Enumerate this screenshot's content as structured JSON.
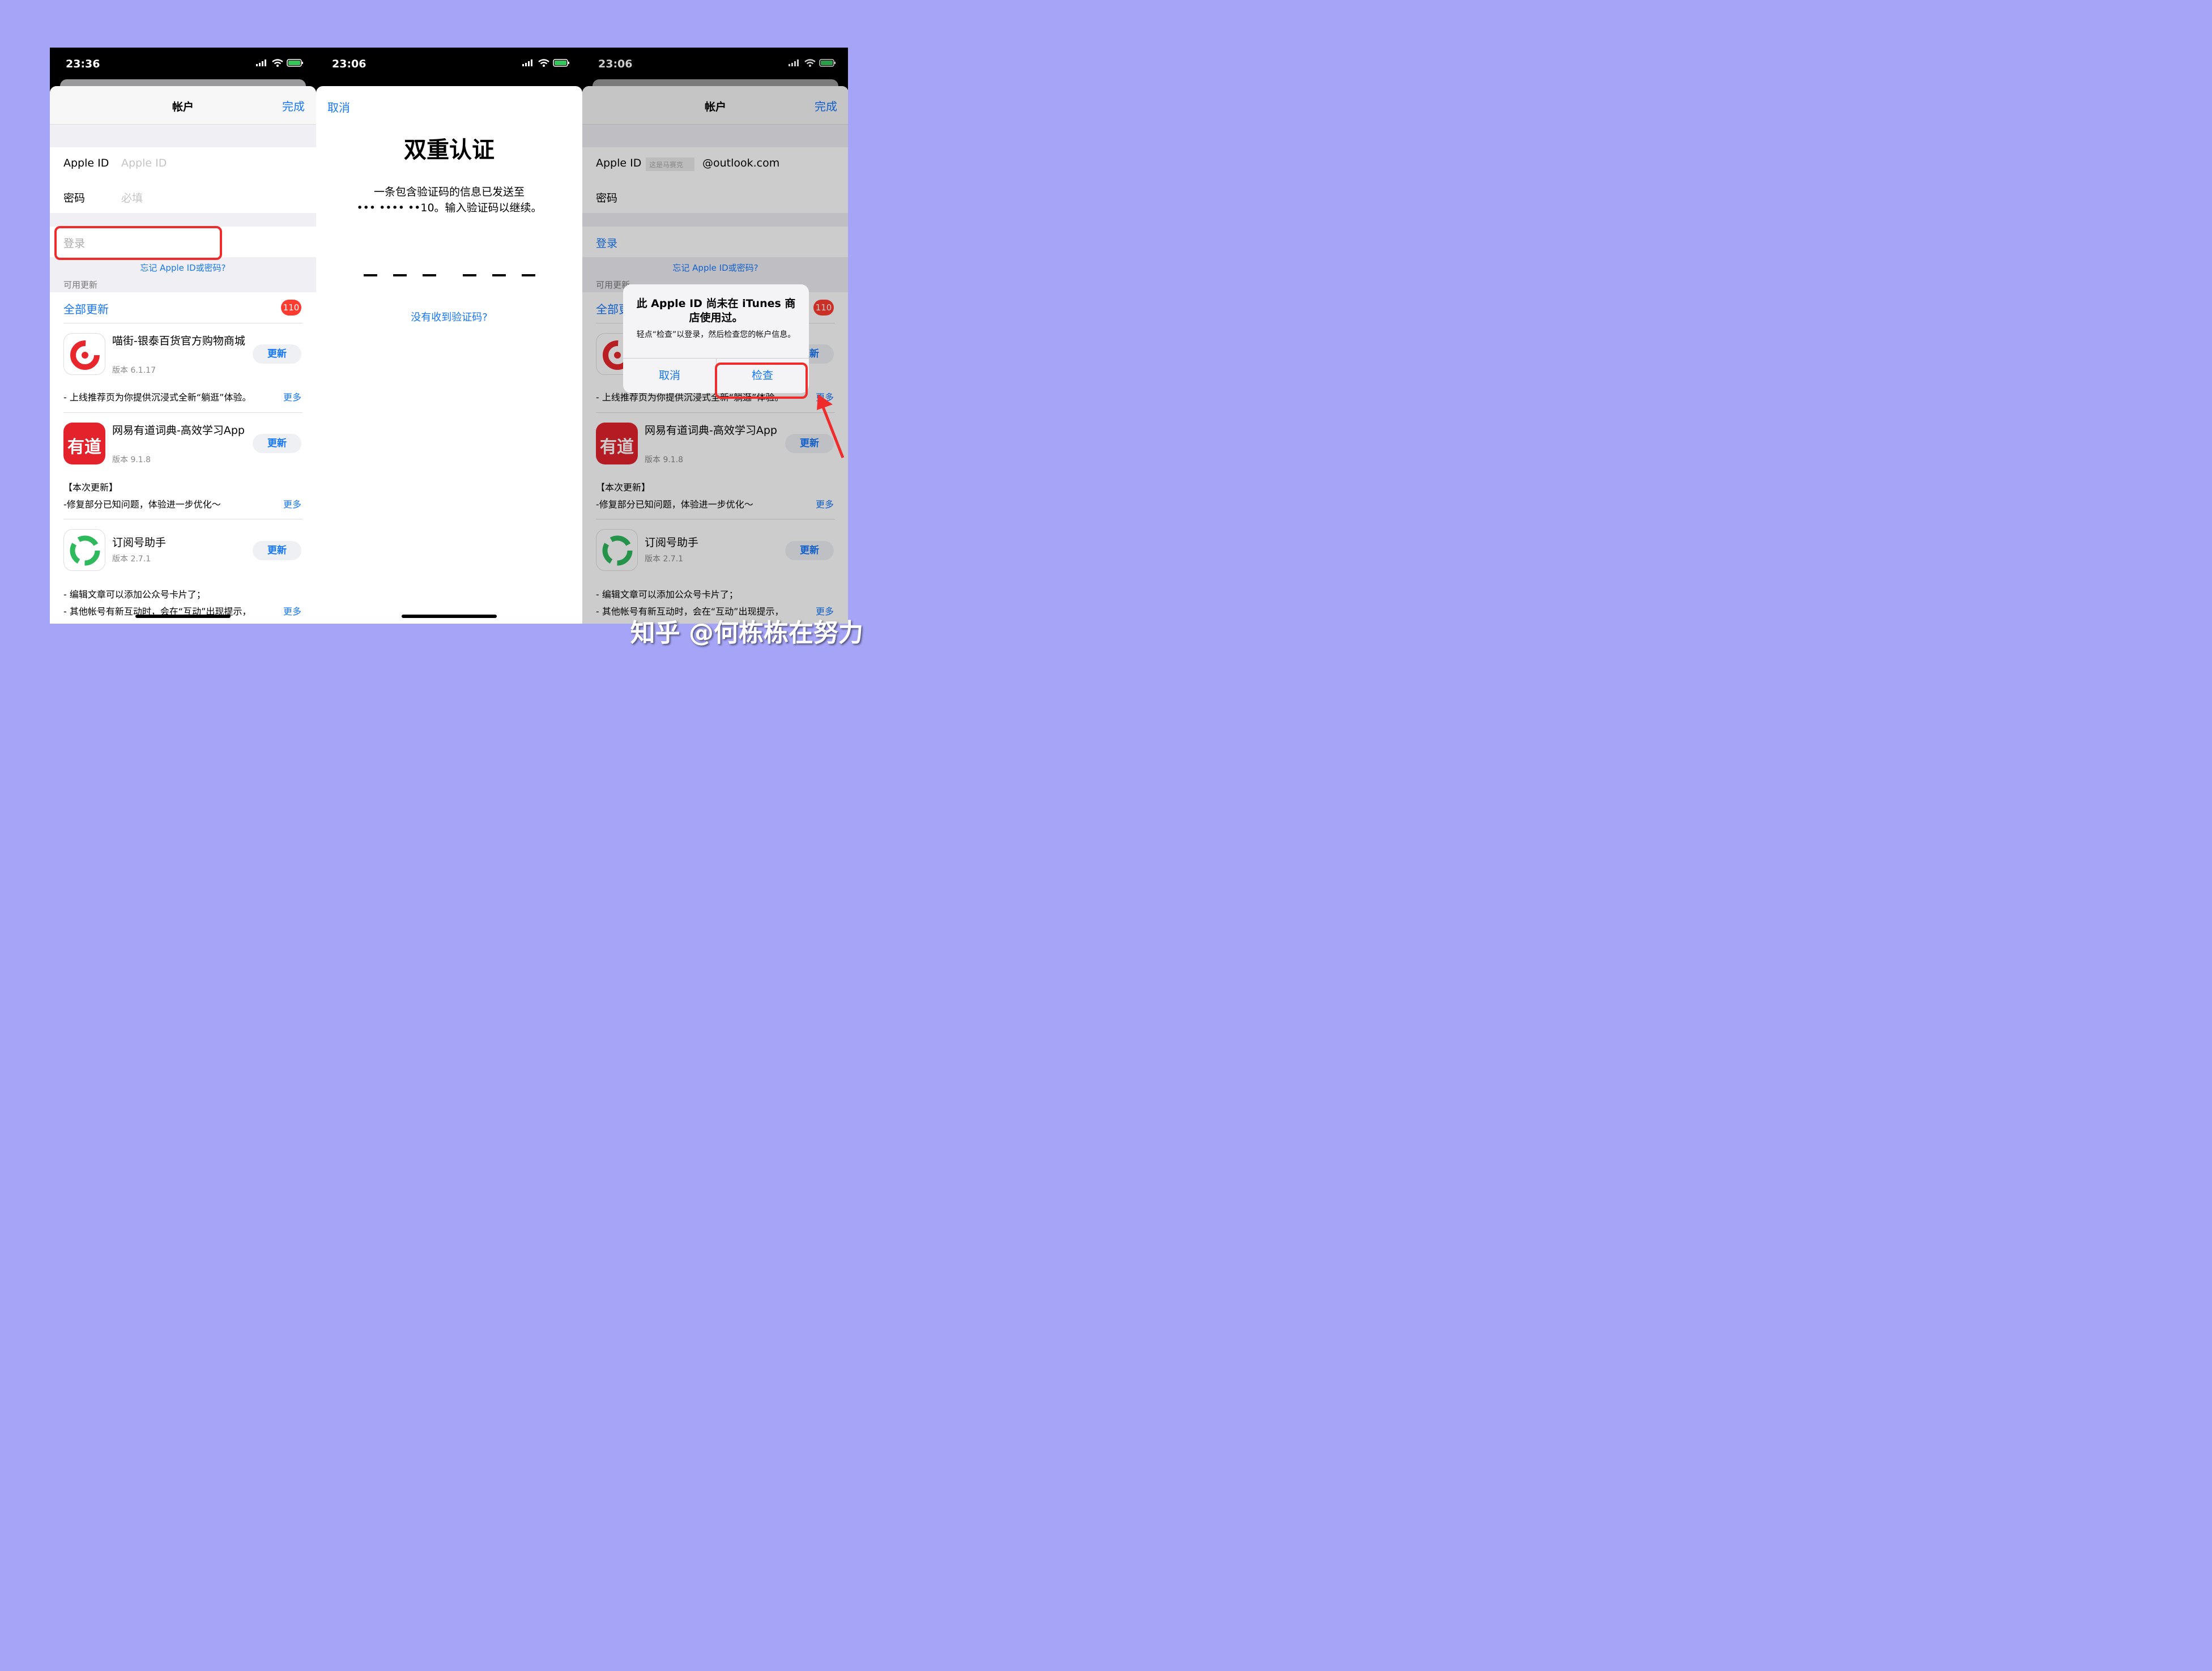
{
  "status_bar": [
    {
      "time": "23:36"
    },
    {
      "time": "23:06"
    },
    {
      "time": "23:06"
    }
  ],
  "account_panel": {
    "title": "帐户",
    "done": "完成",
    "apple_id_label": "Apple ID",
    "apple_id_placeholder": "Apple ID",
    "password_label": "密码",
    "password_placeholder": "必填",
    "login": "登录",
    "forgot": "忘记 Apple ID或密码?",
    "available_updates": "可用更新",
    "update_all": "全部更新",
    "badge_count": "110",
    "apps": [
      {
        "name": "喵街-银泰百货官方购物商城",
        "version": "版本 6.1.17",
        "button": "更新",
        "note": "- 上线推荐页为你提供沉浸式全新“躺逛”体验。",
        "more": "更多"
      },
      {
        "name": "网易有道词典-高效学习App",
        "version": "版本 9.1.8",
        "button": "更新",
        "note_title": "【本次更新】",
        "note": "-修复部分已知问题，体验进一步优化～",
        "more": "更多",
        "icon_text": "有道"
      },
      {
        "name": "订阅号助手",
        "version": "版本 2.7.1",
        "button": "更新",
        "note_line1": "- 编辑文章可以添加公众号卡片了；",
        "note_line2": "- 其他帐号有新互动时，会在“互动”出现提示，",
        "more": "更多"
      }
    ]
  },
  "two_factor": {
    "cancel": "取消",
    "title": "双重认证",
    "message_line1": "一条包含验证码的信息已发送至",
    "message_line2": "••• •••• ••10。输入验证码以继续。",
    "no_code": "没有收到验证码?"
  },
  "panel3": {
    "apple_id_value_prefix": "这是马赛克",
    "apple_id_value_suffix": "@outlook.com",
    "alert": {
      "title": "此 Apple ID 尚未在 iTunes 商店使用过。",
      "message": "轻点“检查”以登录，然后检查您的帐户信息。",
      "cancel": "取消",
      "check": "检查"
    }
  },
  "watermark": "知乎 @何栋栋在努力",
  "colors": {
    "accent": "#1677ff",
    "highlight": "#ef2b2b",
    "background": "#a5a4f7"
  }
}
